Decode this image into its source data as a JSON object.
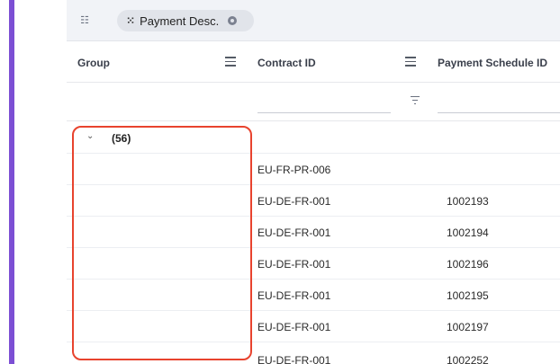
{
  "colors": {
    "accent_bar": "#7c4fd4",
    "highlight": "#e8432e"
  },
  "group_panel": {
    "panel_icon": "group-panel-icon",
    "chip_label": "Payment Desc.",
    "chip_grip_icon": "drag-grip-icon",
    "chip_close_icon": "remove-chip-icon"
  },
  "columns": [
    {
      "label": "Group",
      "menu_icon": "column-menu-icon"
    },
    {
      "label": "Contract ID",
      "menu_icon": "column-menu-icon"
    },
    {
      "label": "Payment Schedule ID"
    }
  ],
  "filter": {
    "icon": "filter-icon"
  },
  "group_row": {
    "toggle_icon": "chevron-down-icon",
    "count": "(56)"
  },
  "rows": [
    {
      "contract_id": "EU-FR-PR-006",
      "payment_schedule_id": ""
    },
    {
      "contract_id": "EU-DE-FR-001",
      "payment_schedule_id": "1002193"
    },
    {
      "contract_id": "EU-DE-FR-001",
      "payment_schedule_id": "1002194"
    },
    {
      "contract_id": "EU-DE-FR-001",
      "payment_schedule_id": "1002196"
    },
    {
      "contract_id": "EU-DE-FR-001",
      "payment_schedule_id": "1002195"
    },
    {
      "contract_id": "EU-DE-FR-001",
      "payment_schedule_id": "1002197"
    },
    {
      "contract_id": "EU-DE-FR-001",
      "payment_schedule_id": "1002252"
    }
  ]
}
